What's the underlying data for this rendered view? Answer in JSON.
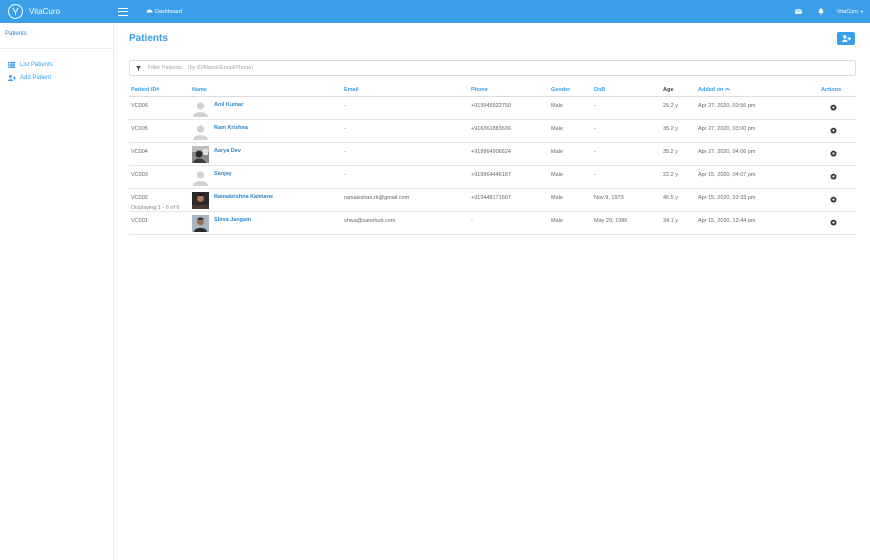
{
  "topbar": {
    "brand_name": "VitaCuro",
    "dashboard_label": "Dashboard",
    "user_label": "VitaCuro",
    "bg_color": "#3a9ee8"
  },
  "sidebar": {
    "heading": "Patients",
    "items": [
      {
        "label": "List Patients",
        "icon": "list-icon"
      },
      {
        "label": "Add Patient",
        "icon": "add-user-icon"
      }
    ]
  },
  "main": {
    "title": "Patients",
    "filter_placeholder": "Filter Patients... (by ID/Name/Email/Phone)",
    "footer": "Displaying 1 - 6 of 6"
  },
  "table": {
    "columns": {
      "id": "Patient ID#",
      "name": "Name",
      "email": "Email",
      "phone": "Phone",
      "gender": "Gender",
      "dob": "DoB",
      "age": "Age",
      "added": "Added on",
      "actions": "Actions"
    },
    "rows": [
      {
        "id": "VC006",
        "name": "Anil Kumar",
        "email": "-",
        "phone": "+919945522750",
        "gender": "Male",
        "dob": "-",
        "age": "25.2 y",
        "added": "Apr 27, 2020, 03:56 pm",
        "avatar": "placeholder"
      },
      {
        "id": "VC005",
        "name": "Ram Krishna",
        "email": "-",
        "phone": "+916361883636",
        "gender": "Male",
        "dob": "-",
        "age": "35.2 y",
        "added": "Apr 27, 2020, 03:00 pm",
        "avatar": "placeholder"
      },
      {
        "id": "VC004",
        "name": "Aarya Dev",
        "email": "-",
        "phone": "+919964906624",
        "gender": "Male",
        "dob": "-",
        "age": "35.2 y",
        "added": "Apr 27, 2020, 04:06 pm",
        "avatar": "photo-bw"
      },
      {
        "id": "VC003",
        "name": "Sanjay",
        "email": "-",
        "phone": "+919964446187",
        "gender": "Male",
        "dob": "-",
        "age": "22.2 y",
        "added": "Apr 15, 2020, 04:07 pm",
        "avatar": "placeholder"
      },
      {
        "id": "VC002",
        "name": "Ramakrishna Kalmane",
        "email": "ramakishan.rk@gmail.com",
        "phone": "+919448171607",
        "gender": "Male",
        "dob": "Nov 9, 1973",
        "age": "46.5 y",
        "added": "Apr 15, 2020, 03:33 pm",
        "avatar": "photo-dark"
      },
      {
        "id": "VC001",
        "name": "Shiva Jangam",
        "email": "shiva@sanohub.com",
        "phone": "-",
        "gender": "Male",
        "dob": "May 29, 1986",
        "age": "34.1 y",
        "added": "Apr 15, 2020, 12:44 pm",
        "avatar": "photo-color"
      }
    ]
  }
}
